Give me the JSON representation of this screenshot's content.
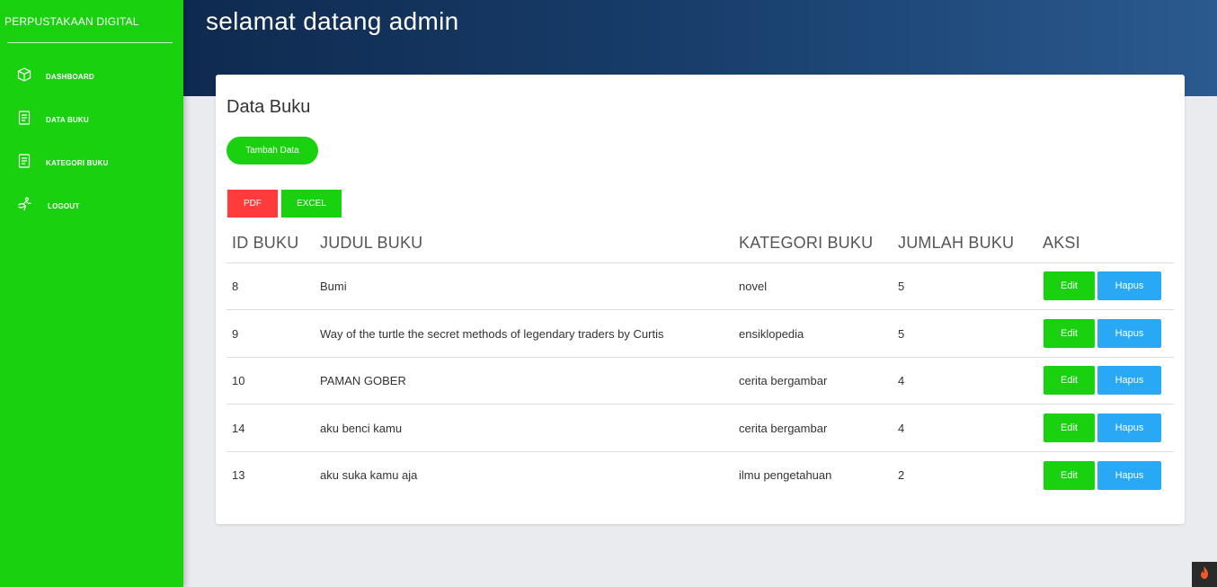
{
  "sidebar": {
    "brand": "PERPUSTAKAAN DIGITAL",
    "items": [
      {
        "label": "DASHBOARD",
        "icon": "cube-icon"
      },
      {
        "label": "DATA BUKU",
        "icon": "document-icon"
      },
      {
        "label": "KATEGORI BUKU",
        "icon": "document-icon"
      },
      {
        "label": "LOGOUT",
        "icon": "running-icon"
      }
    ]
  },
  "header": {
    "welcome": "selamat datang admin"
  },
  "main": {
    "title": "Data Buku",
    "add_button": "Tambah Data",
    "pdf_button": "PDF",
    "excel_button": "EXCEL",
    "table": {
      "headers": [
        "ID BUKU",
        "JUDUL BUKU",
        "KATEGORI BUKU",
        "JUMLAH BUKU",
        "AKSI"
      ],
      "rows": [
        {
          "id": "8",
          "judul": "Bumi",
          "kategori": "novel",
          "jumlah": "5"
        },
        {
          "id": "9",
          "judul": "Way of the turtle the secret methods of legendary traders by Curtis",
          "kategori": "ensiklopedia",
          "jumlah": "5"
        },
        {
          "id": "10",
          "judul": "PAMAN GOBER",
          "kategori": "cerita bergambar",
          "jumlah": "4"
        },
        {
          "id": "14",
          "judul": "aku benci kamu",
          "kategori": "cerita bergambar",
          "jumlah": "4"
        },
        {
          "id": "13",
          "judul": "aku suka kamu aja",
          "kategori": "ilmu pengetahuan",
          "jumlah": "2"
        }
      ],
      "edit_label": "Edit",
      "delete_label": "Hapus"
    }
  },
  "colors": {
    "sidebar": "#19d10f",
    "header_start": "#0f2a4f",
    "header_end": "#2b5a8f",
    "pdf": "#ff3b3b",
    "hapus": "#29a9f5"
  },
  "corner_icon": "flame-icon"
}
